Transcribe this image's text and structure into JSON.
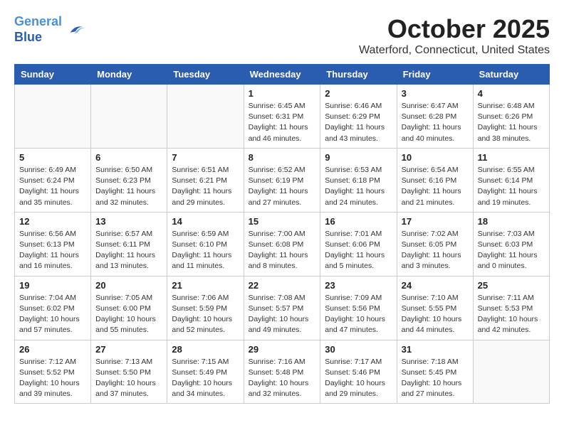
{
  "header": {
    "logo_line1": "General",
    "logo_line2": "Blue",
    "month_title": "October 2025",
    "location": "Waterford, Connecticut, United States"
  },
  "weekdays": [
    "Sunday",
    "Monday",
    "Tuesday",
    "Wednesday",
    "Thursday",
    "Friday",
    "Saturday"
  ],
  "weeks": [
    [
      {
        "day": "",
        "info": ""
      },
      {
        "day": "",
        "info": ""
      },
      {
        "day": "",
        "info": ""
      },
      {
        "day": "1",
        "info": "Sunrise: 6:45 AM\nSunset: 6:31 PM\nDaylight: 11 hours\nand 46 minutes."
      },
      {
        "day": "2",
        "info": "Sunrise: 6:46 AM\nSunset: 6:29 PM\nDaylight: 11 hours\nand 43 minutes."
      },
      {
        "day": "3",
        "info": "Sunrise: 6:47 AM\nSunset: 6:28 PM\nDaylight: 11 hours\nand 40 minutes."
      },
      {
        "day": "4",
        "info": "Sunrise: 6:48 AM\nSunset: 6:26 PM\nDaylight: 11 hours\nand 38 minutes."
      }
    ],
    [
      {
        "day": "5",
        "info": "Sunrise: 6:49 AM\nSunset: 6:24 PM\nDaylight: 11 hours\nand 35 minutes."
      },
      {
        "day": "6",
        "info": "Sunrise: 6:50 AM\nSunset: 6:23 PM\nDaylight: 11 hours\nand 32 minutes."
      },
      {
        "day": "7",
        "info": "Sunrise: 6:51 AM\nSunset: 6:21 PM\nDaylight: 11 hours\nand 29 minutes."
      },
      {
        "day": "8",
        "info": "Sunrise: 6:52 AM\nSunset: 6:19 PM\nDaylight: 11 hours\nand 27 minutes."
      },
      {
        "day": "9",
        "info": "Sunrise: 6:53 AM\nSunset: 6:18 PM\nDaylight: 11 hours\nand 24 minutes."
      },
      {
        "day": "10",
        "info": "Sunrise: 6:54 AM\nSunset: 6:16 PM\nDaylight: 11 hours\nand 21 minutes."
      },
      {
        "day": "11",
        "info": "Sunrise: 6:55 AM\nSunset: 6:14 PM\nDaylight: 11 hours\nand 19 minutes."
      }
    ],
    [
      {
        "day": "12",
        "info": "Sunrise: 6:56 AM\nSunset: 6:13 PM\nDaylight: 11 hours\nand 16 minutes."
      },
      {
        "day": "13",
        "info": "Sunrise: 6:57 AM\nSunset: 6:11 PM\nDaylight: 11 hours\nand 13 minutes."
      },
      {
        "day": "14",
        "info": "Sunrise: 6:59 AM\nSunset: 6:10 PM\nDaylight: 11 hours\nand 11 minutes."
      },
      {
        "day": "15",
        "info": "Sunrise: 7:00 AM\nSunset: 6:08 PM\nDaylight: 11 hours\nand 8 minutes."
      },
      {
        "day": "16",
        "info": "Sunrise: 7:01 AM\nSunset: 6:06 PM\nDaylight: 11 hours\nand 5 minutes."
      },
      {
        "day": "17",
        "info": "Sunrise: 7:02 AM\nSunset: 6:05 PM\nDaylight: 11 hours\nand 3 minutes."
      },
      {
        "day": "18",
        "info": "Sunrise: 7:03 AM\nSunset: 6:03 PM\nDaylight: 11 hours\nand 0 minutes."
      }
    ],
    [
      {
        "day": "19",
        "info": "Sunrise: 7:04 AM\nSunset: 6:02 PM\nDaylight: 10 hours\nand 57 minutes."
      },
      {
        "day": "20",
        "info": "Sunrise: 7:05 AM\nSunset: 6:00 PM\nDaylight: 10 hours\nand 55 minutes."
      },
      {
        "day": "21",
        "info": "Sunrise: 7:06 AM\nSunset: 5:59 PM\nDaylight: 10 hours\nand 52 minutes."
      },
      {
        "day": "22",
        "info": "Sunrise: 7:08 AM\nSunset: 5:57 PM\nDaylight: 10 hours\nand 49 minutes."
      },
      {
        "day": "23",
        "info": "Sunrise: 7:09 AM\nSunset: 5:56 PM\nDaylight: 10 hours\nand 47 minutes."
      },
      {
        "day": "24",
        "info": "Sunrise: 7:10 AM\nSunset: 5:55 PM\nDaylight: 10 hours\nand 44 minutes."
      },
      {
        "day": "25",
        "info": "Sunrise: 7:11 AM\nSunset: 5:53 PM\nDaylight: 10 hours\nand 42 minutes."
      }
    ],
    [
      {
        "day": "26",
        "info": "Sunrise: 7:12 AM\nSunset: 5:52 PM\nDaylight: 10 hours\nand 39 minutes."
      },
      {
        "day": "27",
        "info": "Sunrise: 7:13 AM\nSunset: 5:50 PM\nDaylight: 10 hours\nand 37 minutes."
      },
      {
        "day": "28",
        "info": "Sunrise: 7:15 AM\nSunset: 5:49 PM\nDaylight: 10 hours\nand 34 minutes."
      },
      {
        "day": "29",
        "info": "Sunrise: 7:16 AM\nSunset: 5:48 PM\nDaylight: 10 hours\nand 32 minutes."
      },
      {
        "day": "30",
        "info": "Sunrise: 7:17 AM\nSunset: 5:46 PM\nDaylight: 10 hours\nand 29 minutes."
      },
      {
        "day": "31",
        "info": "Sunrise: 7:18 AM\nSunset: 5:45 PM\nDaylight: 10 hours\nand 27 minutes."
      },
      {
        "day": "",
        "info": ""
      }
    ]
  ]
}
